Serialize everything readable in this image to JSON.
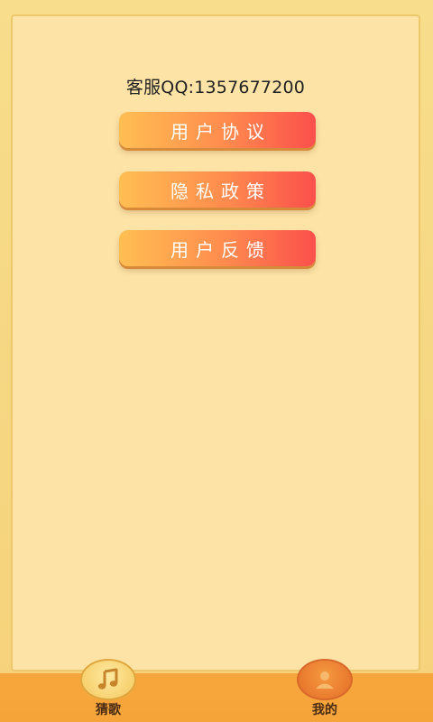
{
  "service": {
    "contact_text": "客服QQ:1357677200"
  },
  "menu": {
    "items": [
      {
        "label": "用户协议"
      },
      {
        "label": "隐私政策"
      },
      {
        "label": "用户反馈"
      }
    ]
  },
  "tabbar": {
    "tabs": [
      {
        "label": "猜歌",
        "icon": "music-note-icon"
      },
      {
        "label": "我的",
        "icon": "user-icon",
        "active": true
      }
    ]
  },
  "colors": {
    "background": "#f7dd8c",
    "panel": "#fde3a6",
    "button_start": "#ffbf52",
    "button_end": "#fb4f4c",
    "tabbar": "#f6a73b"
  }
}
